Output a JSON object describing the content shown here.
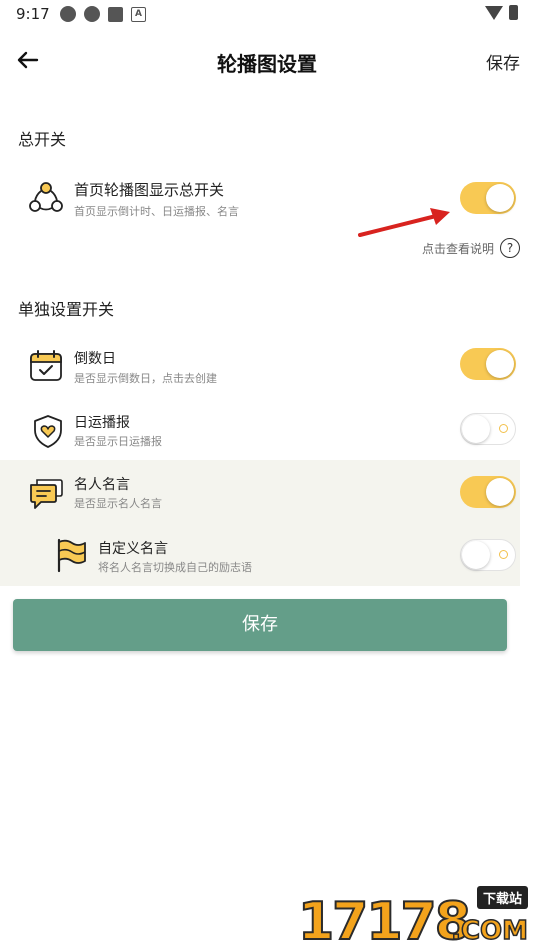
{
  "status_bar": {
    "time": "9:17",
    "icons": [
      "app-circle-icon",
      "app-circle-icon",
      "square-icon",
      "a-icon"
    ],
    "right_icons": [
      "wifi-icon",
      "battery-icon"
    ],
    "a_glyph": "A"
  },
  "header": {
    "back_icon": "arrow-left-icon",
    "title": "轮播图设置",
    "save_label": "保存"
  },
  "sections": {
    "master": {
      "title": "总开关",
      "item": {
        "title": "首页轮播图显示总开关",
        "subtitle": "首页显示倒计时、日运播报、名言",
        "enabled": true
      },
      "help_text": "点击查看说明",
      "help_glyph": "?"
    },
    "individual": {
      "title": "单独设置开关",
      "items": [
        {
          "title": "倒数日",
          "subtitle": "是否显示倒数日，点击去创建",
          "enabled": true,
          "icon": "calendar-icon"
        },
        {
          "title": "日运播报",
          "subtitle": "是否显示日运播报",
          "enabled": false,
          "icon": "shield-heart-icon"
        },
        {
          "title": "名人名言",
          "subtitle": "是否显示名人名言",
          "enabled": true,
          "icon": "chat-bubble-icon"
        },
        {
          "title": "自定义名言",
          "subtitle": "将名人名言切换成自己的励志语",
          "enabled": false,
          "icon": "flag-icon"
        }
      ]
    }
  },
  "save_button": {
    "label": "保存"
  },
  "colors": {
    "accent_yellow": "#f8c954",
    "save_green": "#649e89",
    "highlight_bg": "#f4f4ee",
    "arrow_red": "#d8231f"
  },
  "watermark": {
    "digits": "17178",
    "top_label": "下载站",
    "com_label": ".COM"
  }
}
